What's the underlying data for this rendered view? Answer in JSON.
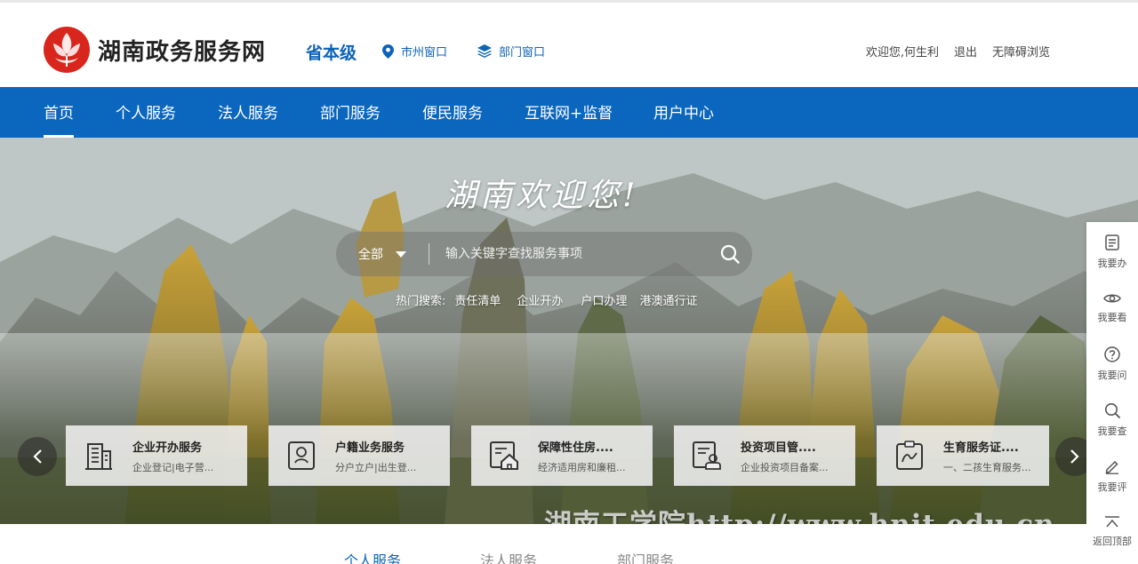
{
  "header": {
    "site_title": "湖南政务服务网",
    "level": "省本级",
    "city_window": "市州窗口",
    "dept_window": "部门窗口",
    "welcome": "欢迎您,何生利",
    "logout": "退出",
    "accessibility": "无障碍浏览"
  },
  "nav": {
    "items": [
      "首页",
      "个人服务",
      "法人服务",
      "部门服务",
      "便民服务",
      "互联网+监督",
      "用户中心"
    ],
    "active": "首页"
  },
  "hero": {
    "slogan": "湖南欢迎您!",
    "search": {
      "scope": "全部",
      "placeholder": "输入关键字查找服务事项"
    },
    "hot_label": "热门搜索:",
    "hot_items": [
      "责任清单",
      "企业开办",
      "户口办理",
      "港澳通行证"
    ],
    "cards": [
      {
        "title": "企业开办服务",
        "desc": "企业登记|电子营...",
        "icon": "building-icon"
      },
      {
        "title": "户籍业务服务",
        "desc": "分户立户|出生登...",
        "icon": "id-card-icon"
      },
      {
        "title": "保障性住房....",
        "desc": "经济适用房和廉租...",
        "icon": "house-icon"
      },
      {
        "title": "投资项目管....",
        "desc": "企业投资项目备案...",
        "icon": "document-stamp-icon"
      },
      {
        "title": "生育服务证....",
        "desc": "一、二孩生育服务...",
        "icon": "certificate-icon"
      }
    ],
    "watermark": "湖南工学院http://www.hnit.edu.cn"
  },
  "sidebar": {
    "items": [
      "我要办",
      "我要看",
      "我要问",
      "我要查",
      "我要评",
      "返回顶部"
    ]
  },
  "bottom_tabs": {
    "items": [
      "个人服务",
      "法人服务",
      "部门服务"
    ],
    "active": "个人服务"
  },
  "colors": {
    "brand_blue": "#0b66be",
    "logo_red": "#d9261c"
  }
}
